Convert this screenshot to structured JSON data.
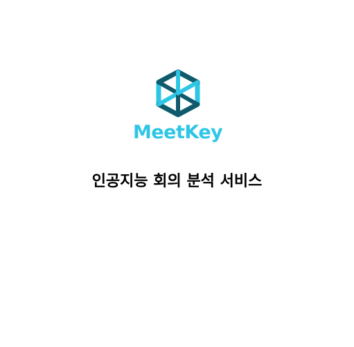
{
  "brand": {
    "name": "MeetKey",
    "logo_icon": "cube-hexagon-logo-icon",
    "colors": {
      "primary": "#2fc6e6",
      "dark": "#0f5a6b"
    }
  },
  "main": {
    "title": "인공지능 회의 분석 서비스"
  }
}
